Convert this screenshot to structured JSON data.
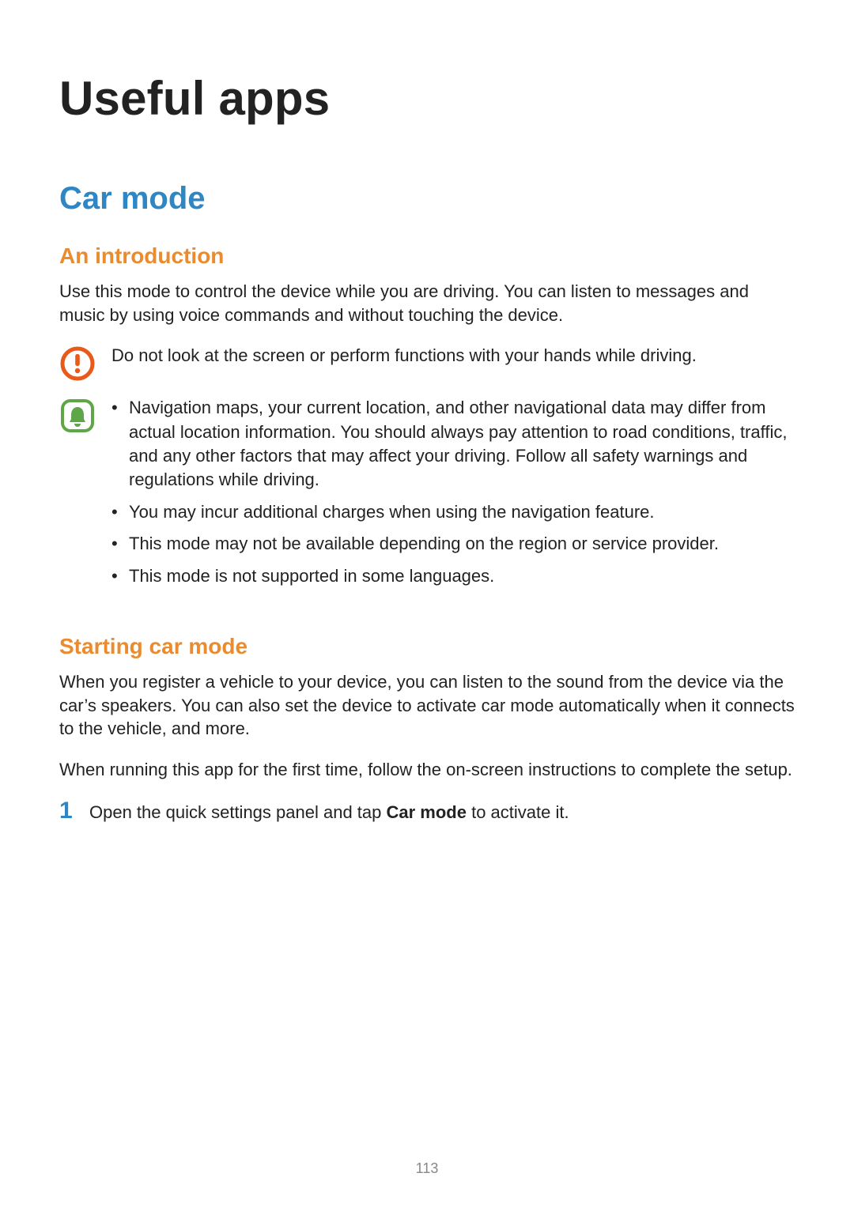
{
  "chapter_title": "Useful apps",
  "section_title": "Car mode",
  "intro": {
    "heading": "An introduction",
    "paragraph": "Use this mode to control the device while you are driving. You can listen to messages and music by using voice commands and without touching the device."
  },
  "warning_note": "Do not look at the screen or perform functions with your hands while driving.",
  "info_bullets": [
    "Navigation maps, your current location, and other navigational data may differ from actual location information. You should always pay attention to road conditions, traffic, and any other factors that may affect your driving. Follow all safety warnings and regulations while driving.",
    "You may incur additional charges when using the navigation feature.",
    "This mode may not be available depending on the region or service provider.",
    "This mode is not supported in some languages."
  ],
  "starting": {
    "heading": "Starting car mode",
    "para1": "When you register a vehicle to your device, you can listen to the sound from the device via the car’s speakers. You can also set the device to activate car mode automatically when it connects to the vehicle, and more.",
    "para2": "When running this app for the first time, follow the on-screen instructions to complete the setup.",
    "step_number": "1",
    "step_text_pre": "Open the quick settings panel and tap ",
    "step_text_bold": "Car mode",
    "step_text_post": " to activate it."
  },
  "page_number": "113"
}
